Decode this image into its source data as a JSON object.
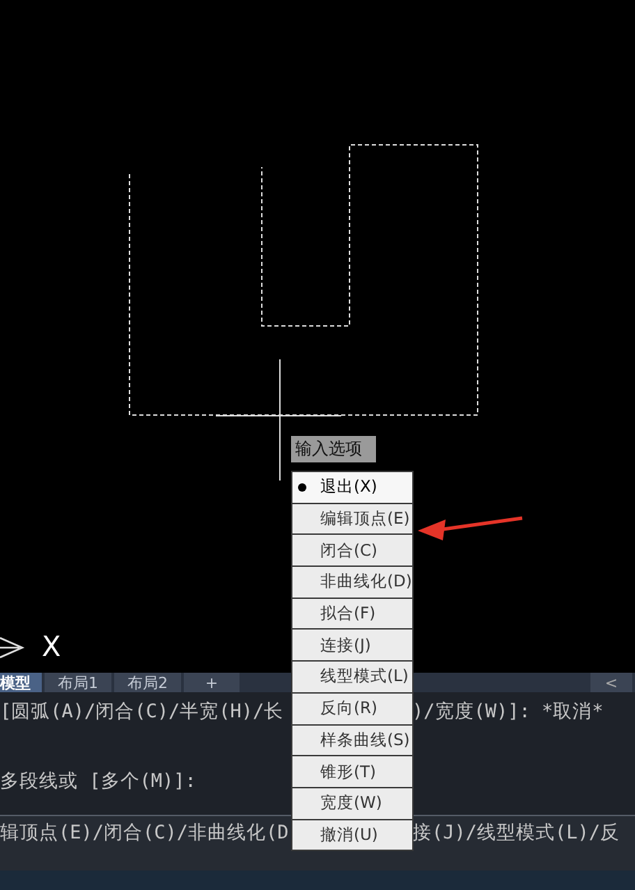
{
  "canvas": {
    "tooltip": "输入选项",
    "ucs_axis_label": "X"
  },
  "menu": {
    "items": [
      {
        "label": "退出(X)",
        "selected": true
      },
      {
        "label": "编辑顶点(E)",
        "selected": false
      },
      {
        "label": "闭合(C)",
        "selected": false
      },
      {
        "label": "非曲线化(D)",
        "selected": false
      },
      {
        "label": "拟合(F)",
        "selected": false
      },
      {
        "label": "连接(J)",
        "selected": false
      },
      {
        "label": "线型模式(L)",
        "selected": false
      },
      {
        "label": "反向(R)",
        "selected": false
      },
      {
        "label": "样条曲线(S)",
        "selected": false
      },
      {
        "label": "锥形(T)",
        "selected": false
      },
      {
        "label": "宽度(W)",
        "selected": false
      },
      {
        "label": "撤消(U)",
        "selected": false
      }
    ]
  },
  "tabs": [
    {
      "label": "模型",
      "selected": true
    },
    {
      "label": "布局1",
      "selected": false
    },
    {
      "label": "布局2",
      "selected": false
    },
    {
      "label": "+",
      "selected": false
    }
  ],
  "tab_scroll": "<",
  "command_history": [
    {
      "left": "[圆弧(A)/闭合(C)/半宽(H)/长",
      "right": ")/宽度(W)]: *取消*"
    },
    {
      "left": "多段线或 [多个(M)]:"
    }
  ],
  "command_prompt": {
    "left": "辑顶点(E)/闭合(C)/非曲线化(D",
    "right": "接(J)/线型模式(L)/反"
  }
}
